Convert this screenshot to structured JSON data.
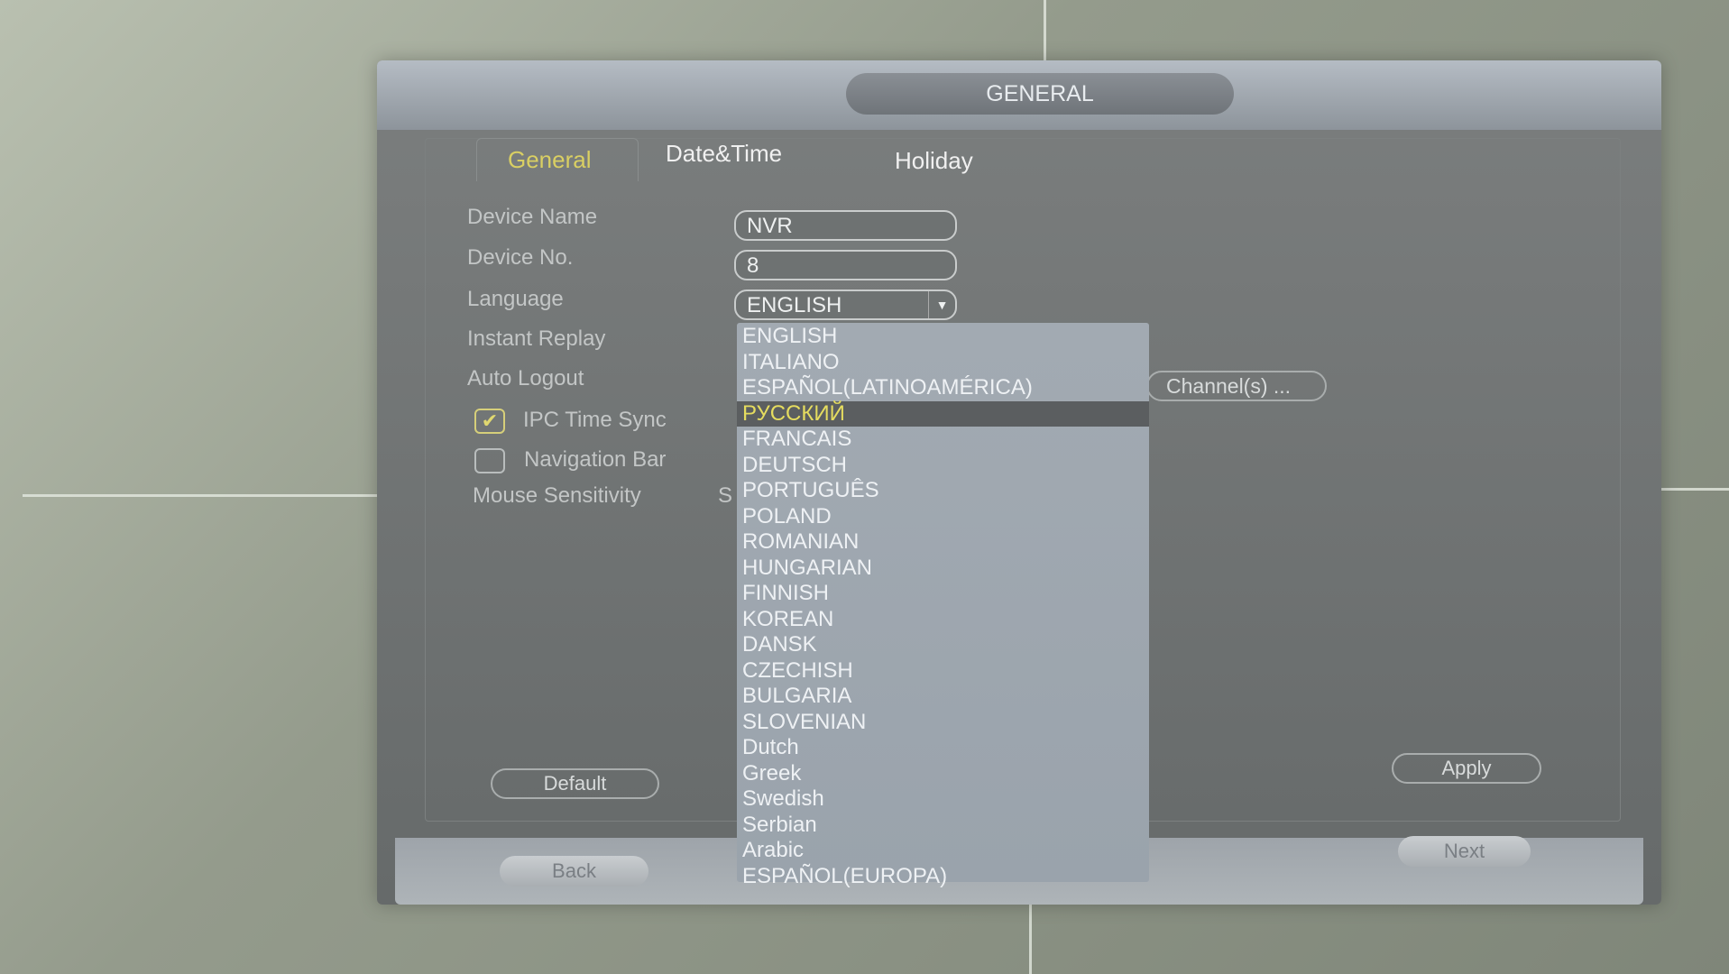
{
  "window": {
    "title": "GENERAL"
  },
  "tabs": [
    {
      "label": "General",
      "active": true
    },
    {
      "label": "Date&Time"
    },
    {
      "label": "Holiday"
    }
  ],
  "form": {
    "device_name_label": "Device Name",
    "device_name_value": "NVR",
    "device_no_label": "Device No.",
    "device_no_value": "8",
    "language_label": "Language",
    "language_value": "ENGLISH",
    "instant_replay_label": "Instant Replay",
    "auto_logout_label": "Auto Logout",
    "channels_button": "Channel(s) ...",
    "ipc_time_sync_label": "IPC Time Sync",
    "ipc_time_sync_checked": true,
    "navigation_bar_label": "Navigation Bar",
    "navigation_bar_checked": false,
    "mouse_sensitivity_label": "Mouse Sensitivity",
    "mouse_sensitivity_value_partial": "S"
  },
  "language_options": [
    "ENGLISH",
    "ITALIANO",
    "ESPAÑOL(LATINOAMÉRICA)",
    "РУССКИЙ",
    "FRANCAIS",
    "DEUTSCH",
    "PORTUGUÊS",
    "POLAND",
    "ROMANIAN",
    "HUNGARIAN",
    "FINNISH",
    "KOREAN",
    "DANSK",
    "CZECHISH",
    "BULGARIA",
    "SLOVENIAN",
    "Dutch",
    "Greek",
    "Swedish",
    "Serbian",
    "Arabic",
    "ESPAÑOL(EUROPA)"
  ],
  "highlighted_option_index": 3,
  "buttons": {
    "default": "Default",
    "apply": "Apply",
    "back": "Back",
    "next": "Next"
  },
  "colors": {
    "active_tab": "#d9cf63",
    "highlight_text": "#e5dc5f",
    "highlight_bg": "#5b5e60",
    "dropdown_bg": "#9ea7b0"
  }
}
